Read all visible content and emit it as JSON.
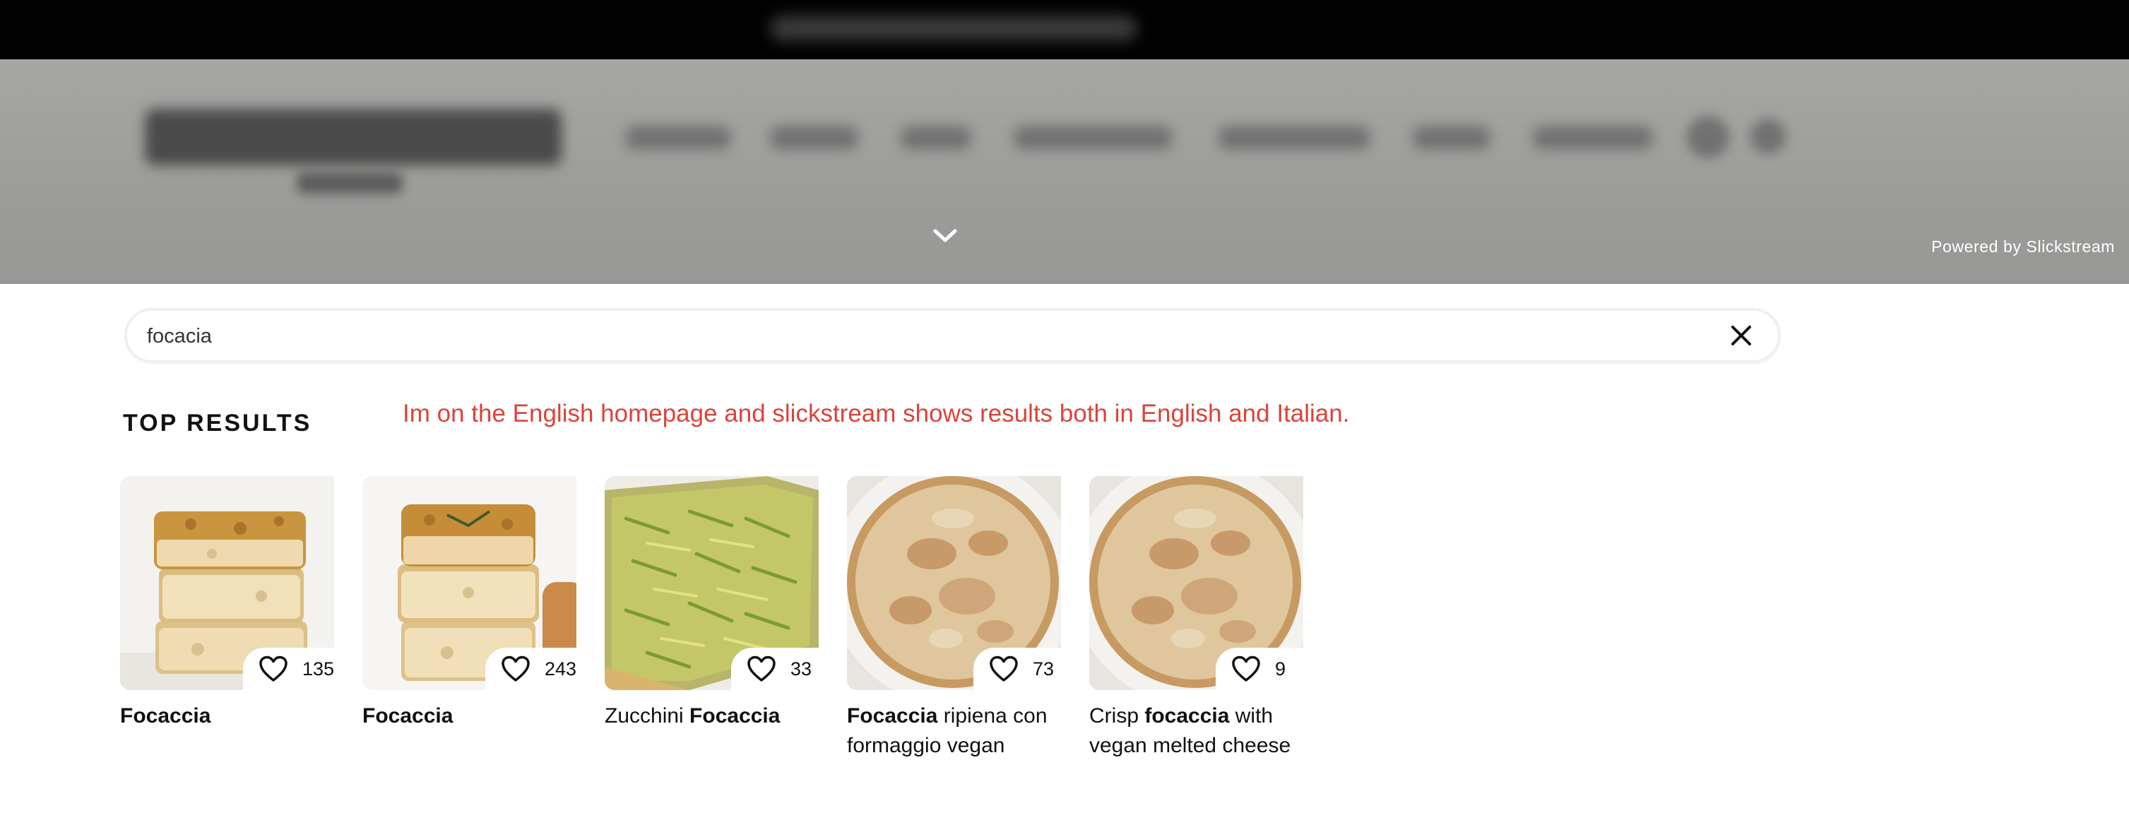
{
  "overlay": {
    "powered_by": "Powered by Slickstream"
  },
  "search": {
    "query": "focacia"
  },
  "results": {
    "heading": "TOP RESULTS",
    "annotation": "Im on the English homepage and slickstream shows results both in English and Italian.",
    "items": [
      {
        "pre": "",
        "bold": "Focaccia",
        "post": "",
        "likes": "135"
      },
      {
        "pre": "",
        "bold": "Focaccia",
        "post": "",
        "likes": "243"
      },
      {
        "pre": "Zucchini ",
        "bold": "Focaccia",
        "post": "",
        "likes": "33"
      },
      {
        "pre": "",
        "bold": "Focaccia",
        "post": " ripiena con formaggio vegan",
        "likes": "73"
      },
      {
        "pre": "Crisp ",
        "bold": "focaccia",
        "post": " with vegan melted cheese",
        "likes": "9"
      }
    ]
  },
  "colors": {
    "annotation": "#d9443a",
    "topbar": "#020202",
    "overlay": "#9c9c9a"
  },
  "icons": {
    "collapse": "chevron-down-icon",
    "clear": "close-icon",
    "favorite": "heart-outline-icon"
  }
}
